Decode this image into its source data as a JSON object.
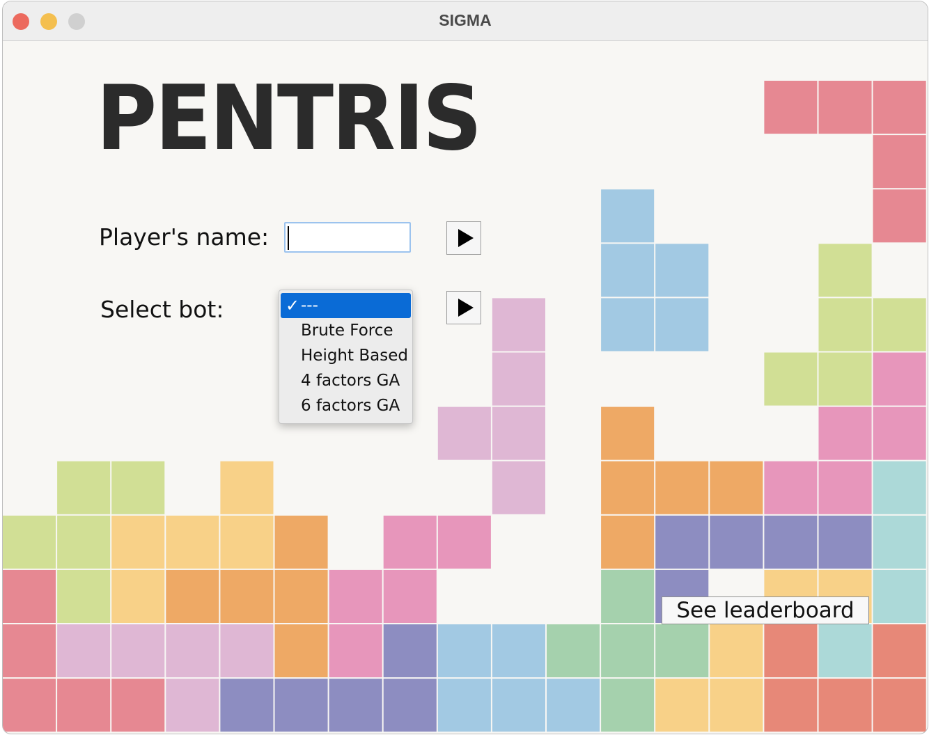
{
  "window": {
    "title": "SIGMA"
  },
  "main": {
    "title": "PENTRIS",
    "player_name_label": "Player's name:",
    "player_name_value": "",
    "select_bot_label": "Select bot:",
    "leaderboard_label": "See leaderboard"
  },
  "bot_select": {
    "check_glyph": "✓",
    "options": [
      "---",
      "Brute Force",
      "Height Based",
      "4 factors GA",
      "6 factors GA"
    ],
    "selected_index": 0
  },
  "colors": {
    "red": "#e68892",
    "green": "#d1df95",
    "yellow": "#f8d188",
    "orange": "#eea965",
    "pink": "#e796bb",
    "lilac": "#dfb7d4",
    "purple": "#8d8dc1",
    "blue": "#a2c9e3",
    "mint": "#a5d1ad",
    "teal": "#acd9d8",
    "salmon": "#e78878"
  },
  "board": {
    "cols": 17,
    "rows": 12,
    "grid": [
      "..............RRR",
      "................R",
      "...........B....R",
      "...........BB..G.",
      ".........L.BB..GG",
      ".........L....GGP",
      "........LL.O...PP",
      ".GG.Y....L.OOOPPT",
      "GGYYYO.PP..OUUUUT",
      "RGYOOOPP...MU.YYTT",
      "RLLLLOPUBBMMMYSTS",
      "RRRLUUUUBBBMYYSSS"
    ]
  }
}
